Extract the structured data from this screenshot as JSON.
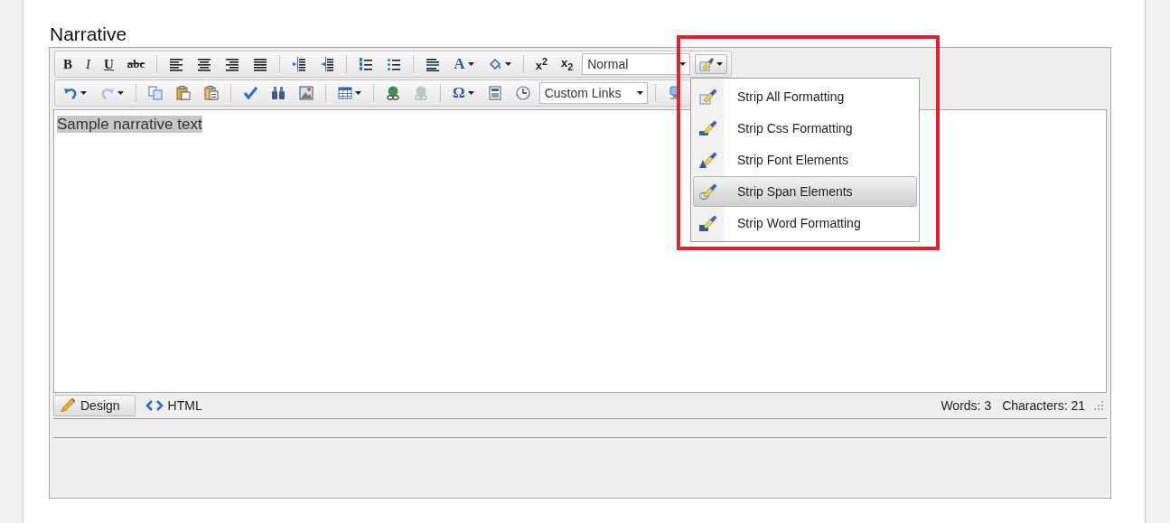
{
  "heading": "Narrative",
  "toolbar_row_1": [
    {
      "kind": "bold",
      "glyph": "B"
    },
    {
      "kind": "italic",
      "glyph": "I"
    },
    {
      "kind": "underline",
      "glyph": "U"
    },
    {
      "kind": "strikethrough",
      "glyph": "abc"
    },
    {
      "kind": "separator"
    },
    {
      "kind": "align-left"
    },
    {
      "kind": "align-center"
    },
    {
      "kind": "align-right"
    },
    {
      "kind": "align-justify"
    },
    {
      "kind": "separator"
    },
    {
      "kind": "indent"
    },
    {
      "kind": "outdent"
    },
    {
      "kind": "separator"
    },
    {
      "kind": "numbered-list"
    },
    {
      "kind": "bulleted-list"
    },
    {
      "kind": "separator"
    },
    {
      "kind": "paragraph"
    },
    {
      "kind": "font-color",
      "glyph": "A",
      "dropdown": true
    },
    {
      "kind": "paint-bucket",
      "dropdown": true
    },
    {
      "kind": "separator"
    },
    {
      "kind": "superscript",
      "glyph": "x$^{2}$"
    },
    {
      "kind": "subscript",
      "glyph": "x$_{2}$"
    },
    {
      "kind": "select",
      "value": "Normal"
    },
    {
      "kind": "brush",
      "dropdown": true,
      "open": true
    }
  ],
  "toolbar_row_2": [
    {
      "kind": "undo",
      "dropdown": true,
      "disabled": false
    },
    {
      "kind": "redo",
      "dropdown": true,
      "disabled": true
    },
    {
      "kind": "separator"
    },
    {
      "kind": "copy"
    },
    {
      "kind": "paste"
    },
    {
      "kind": "paste-text"
    },
    {
      "kind": "separator"
    },
    {
      "kind": "spellcheck"
    },
    {
      "kind": "binoculars"
    },
    {
      "kind": "image"
    },
    {
      "kind": "separator"
    },
    {
      "kind": "table",
      "dropdown": true
    },
    {
      "kind": "separator"
    },
    {
      "kind": "link",
      "disabled": false
    },
    {
      "kind": "link",
      "disabled": true
    },
    {
      "kind": "separator"
    },
    {
      "kind": "special-character",
      "glyph": "Ω",
      "dropdown": true
    },
    {
      "kind": "template"
    },
    {
      "kind": "clock"
    },
    {
      "kind": "select",
      "value": "Custom Links"
    },
    {
      "kind": "separator"
    },
    {
      "kind": "monitor"
    }
  ],
  "content": {
    "text": "Sample narrative text",
    "highlighted": true
  },
  "format_menu": [
    {
      "label": "Strip All Formatting",
      "selected": false
    },
    {
      "label": "Strip Css Formatting",
      "selected": false
    },
    {
      "label": "Strip Font Elements",
      "selected": false
    },
    {
      "label": "Strip Span Elements",
      "selected": true
    },
    {
      "label": "Strip Word Formatting",
      "selected": false
    }
  ],
  "mode_tabs": [
    {
      "label": "Design",
      "kind": "pencil",
      "selected": true
    },
    {
      "label": "HTML",
      "kind": "code",
      "selected": false
    }
  ],
  "status": {
    "words": "Words: 3",
    "characters": "Characters: 21"
  }
}
